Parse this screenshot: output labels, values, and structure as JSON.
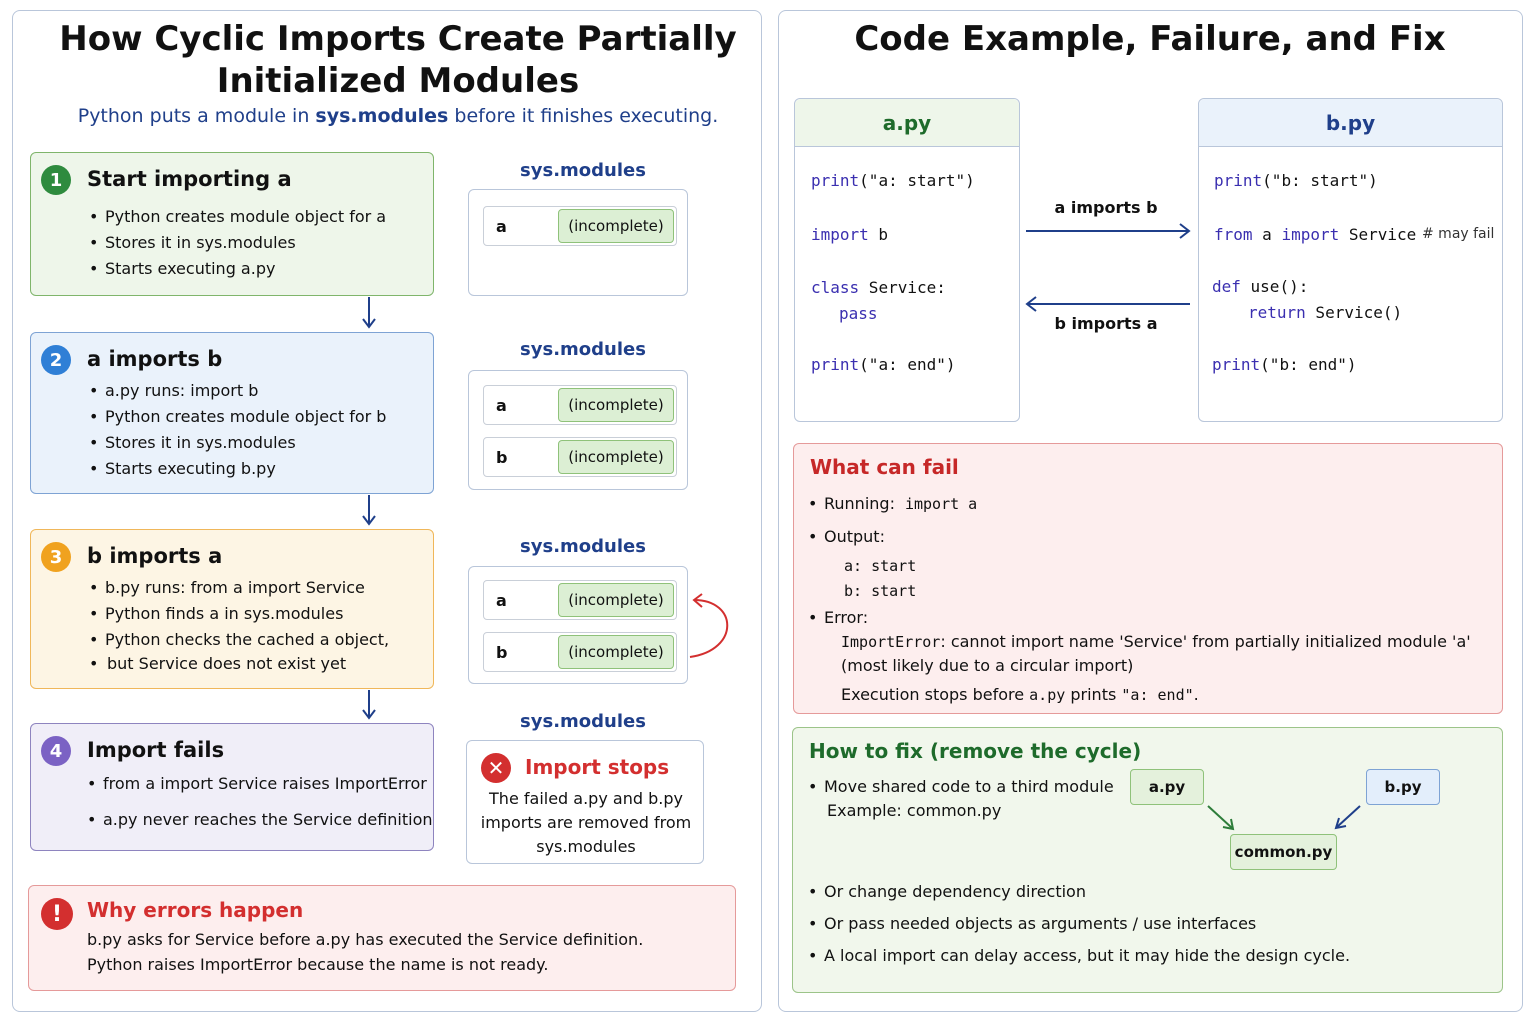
{
  "left": {
    "title_line1": "How Cyclic Imports Create Partially",
    "title_line2": "Initialized Modules",
    "subtitle_pre": "Python puts a module in ",
    "subtitle_bold": "sys.modules",
    "subtitle_post": " before it finishes executing.",
    "steps": [
      {
        "num": "1",
        "heading": "Start importing a",
        "bullets": [
          "Python creates module object for a",
          "Stores it in sys.modules",
          "Starts executing a.py"
        ]
      },
      {
        "num": "2",
        "heading": "a imports b",
        "bullets": [
          "a.py runs: import b",
          "Python creates module object for b",
          "Stores it in sys.modules",
          "Starts executing b.py"
        ]
      },
      {
        "num": "3",
        "heading": "b imports a",
        "bullets": [
          "b.py runs: from a import Service",
          "Python finds a in sys.modules",
          "Python checks the cached a object,",
          "but Service does not exist yet"
        ]
      },
      {
        "num": "4",
        "heading": "Import fails",
        "bullets": [
          "from a import Service raises ImportError",
          "a.py never reaches the Service definition"
        ]
      }
    ],
    "sys_label": "sys.modules",
    "mod_a": "a",
    "mod_b": "b",
    "incomplete": "(incomplete)",
    "stops": {
      "title": "Import stops",
      "line1": "The failed a.py and b.py",
      "line2": "imports are removed from",
      "line3": "sys.modules"
    },
    "why": {
      "title": "Why errors happen",
      "line1": "b.py asks for Service before a.py has executed the Service definition.",
      "line2": "Python raises ImportError because the name is not ready."
    }
  },
  "right": {
    "title": "Code Example, Failure, and Fix",
    "a_file": "a.py",
    "b_file": "b.py",
    "a_code": {
      "l1_kw": "print",
      "l1_rest": "(\"a: start\")",
      "l2_kw": "import",
      "l2_rest": " b",
      "l3_kw": "class",
      "l3_rest": " Service:",
      "l4_kw": "pass",
      "l5_kw": "print",
      "l5_rest": "(\"a: end\")"
    },
    "b_code": {
      "l1_kw": "print",
      "l1_rest": "(\"b: start\")",
      "l2_kw1": "from",
      "l2_mid": " a ",
      "l2_kw2": "import",
      "l2_rest": " Service",
      "l2_comment": "# may fail",
      "l3_kw": "def",
      "l3_rest": " use():",
      "l4_kw": "return",
      "l4_rest": " Service()",
      "l5_kw": "print",
      "l5_rest": "(\"b: end\")"
    },
    "arrow_ab": "a imports b",
    "arrow_ba": "b imports a",
    "fail": {
      "title": "What can fail",
      "running_label": "Running:",
      "running_code": "import a",
      "output_label": "Output:",
      "out1": "a:  start",
      "out2": "b:  start",
      "error_label": "Error:",
      "err_code": "ImportError",
      "err_text": ": cannot import name 'Service' from partially initialized module 'a'",
      "err_line2": "(most likely due to a circular import)",
      "stop_pre": "Execution stops before ",
      "stop_code1": "a.py",
      "stop_mid": " prints ",
      "stop_code2": "\"a: end\"",
      "stop_post": "."
    },
    "fix": {
      "title": "How to fix (remove the cycle)",
      "b1_line1": "Move shared code to a third module",
      "b1_line2": "Example: common.py",
      "mod_a": "a.py",
      "mod_b": "b.py",
      "mod_common": "common.py",
      "b2": "Or change dependency direction",
      "b3": "Or pass needed objects as arguments / use interfaces",
      "b4": "A local import can delay access, but it may hide the design cycle."
    }
  },
  "colors": {
    "green": "#2e8b3e",
    "blue": "#2f7fd6",
    "orange": "#f0a21f",
    "purple": "#7b62c4",
    "red": "#d32f2f",
    "navy": "#1f3f8a"
  }
}
